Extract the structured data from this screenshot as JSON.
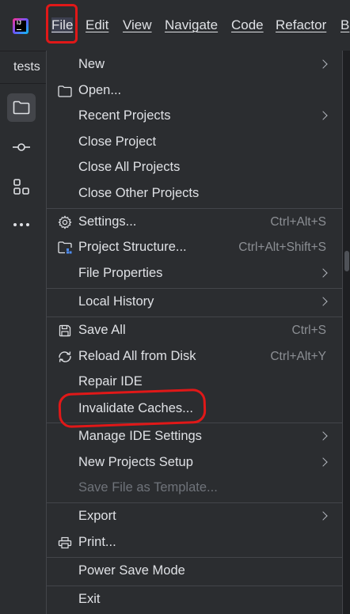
{
  "menubar": {
    "logo_text": "IJ",
    "items": [
      {
        "label": "File",
        "underline": "F"
      },
      {
        "label": "Edit"
      },
      {
        "label": "View"
      },
      {
        "label": "Navigate"
      },
      {
        "label": "Code"
      },
      {
        "label": "Refactor"
      },
      {
        "label": "B"
      }
    ]
  },
  "project_tab": {
    "label": "tests"
  },
  "file_menu": {
    "items": [
      {
        "label": "New",
        "submenu": true
      },
      {
        "label": "Open...",
        "icon": "folder-icon"
      },
      {
        "label": "Recent Projects",
        "submenu": true
      },
      {
        "label": "Close Project"
      },
      {
        "label": "Close All Projects"
      },
      {
        "label": "Close Other Projects"
      },
      {
        "label": "Settings...",
        "icon": "gear-icon",
        "shortcut": "Ctrl+Alt+S"
      },
      {
        "label": "Project Structure...",
        "icon": "project-structure-icon",
        "shortcut": "Ctrl+Alt+Shift+S"
      },
      {
        "label": "File Properties",
        "submenu": true
      },
      {
        "label": "Local History",
        "submenu": true
      },
      {
        "label": "Save All",
        "icon": "save-icon",
        "shortcut": "Ctrl+S"
      },
      {
        "label": "Reload All from Disk",
        "icon": "reload-icon",
        "shortcut": "Ctrl+Alt+Y"
      },
      {
        "label": "Repair IDE"
      },
      {
        "label": "Invalidate Caches..."
      },
      {
        "label": "Manage IDE Settings",
        "submenu": true
      },
      {
        "label": "New Projects Setup",
        "submenu": true
      },
      {
        "label": "Save File as Template...",
        "disabled": true
      },
      {
        "label": "Export",
        "submenu": true
      },
      {
        "label": "Print...",
        "icon": "print-icon"
      },
      {
        "label": "Power Save Mode"
      },
      {
        "label": "Exit"
      }
    ]
  },
  "colors": {
    "background": "#2b2d30",
    "separator": "#43454a",
    "text": "#dfe1e5",
    "shortcut": "#8c8f94",
    "disabled": "#6f737a",
    "annotation": "#e01818"
  }
}
